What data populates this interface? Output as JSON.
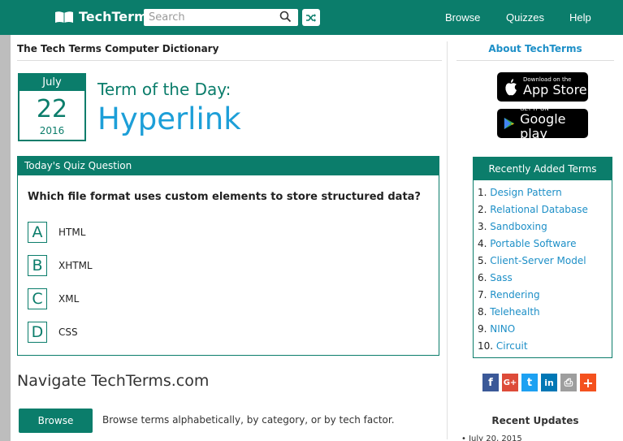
{
  "header": {
    "logo_text": "TechTerms",
    "search_placeholder": "Search",
    "nav": [
      "Browse",
      "Quizzes",
      "Help"
    ]
  },
  "main": {
    "dictionary_title": "The Tech Terms Computer Dictionary",
    "date": {
      "month": "July",
      "day": "22",
      "year": "2016"
    },
    "term_of_day_label": "Term of the Day:",
    "term_of_day": "Hyperlink",
    "quiz": {
      "heading": "Today's Quiz Question",
      "question": "Which file format uses custom elements to store structured data?",
      "options": [
        {
          "letter": "A",
          "text": "HTML"
        },
        {
          "letter": "B",
          "text": "XHTML"
        },
        {
          "letter": "C",
          "text": "XML"
        },
        {
          "letter": "D",
          "text": "CSS"
        }
      ]
    },
    "navigate_title": "Navigate TechTerms.com",
    "browse_button": "Browse",
    "browse_description": "Browse terms alphabetically, by category, or by tech factor."
  },
  "sidebar": {
    "about": "About TechTerms",
    "app_store": {
      "small": "Download on the",
      "big": "App Store"
    },
    "google_play": {
      "small": "GET IT ON",
      "big": "Google play"
    },
    "recent_heading": "Recently Added Terms",
    "recent_terms": [
      {
        "num": "1.",
        "term": "Design Pattern"
      },
      {
        "num": "2.",
        "term": "Relational Database"
      },
      {
        "num": "3.",
        "term": "Sandboxing"
      },
      {
        "num": "4.",
        "term": "Portable Software"
      },
      {
        "num": "5.",
        "term": "Client-Server Model"
      },
      {
        "num": "6.",
        "term": "Sass"
      },
      {
        "num": "7.",
        "term": "Rendering"
      },
      {
        "num": "8.",
        "term": "Telehealth"
      },
      {
        "num": "9.",
        "term": "NINO"
      },
      {
        "num": "10.",
        "term": "Circuit"
      }
    ],
    "social": [
      {
        "icon": "facebook-icon",
        "glyph": "f",
        "color": "#3b5998"
      },
      {
        "icon": "google-plus-icon",
        "glyph": "G+",
        "color": "#dd4b39"
      },
      {
        "icon": "twitter-icon",
        "glyph": "t",
        "color": "#1da1f2"
      },
      {
        "icon": "linkedin-icon",
        "glyph": "in",
        "color": "#0077b5"
      },
      {
        "icon": "print-icon",
        "glyph": "⎙",
        "color": "#9e9e9e"
      },
      {
        "icon": "plus-icon",
        "glyph": "+",
        "color": "#f4511e"
      }
    ],
    "updates_heading": "Recent Updates",
    "update_first": "July 20, 2015"
  },
  "colors": {
    "brand": "#0b7d6b",
    "link": "#1d8fc7",
    "term": "#1d9fd8"
  }
}
